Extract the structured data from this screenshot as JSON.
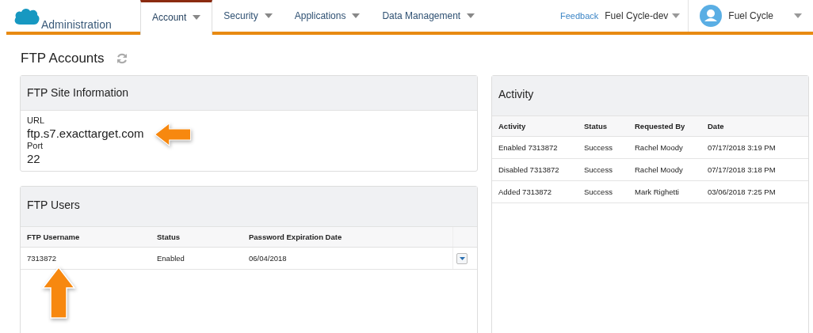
{
  "header": {
    "app_name": "Administration",
    "tabs": [
      {
        "label": "Account",
        "selected": true
      },
      {
        "label": "Security",
        "selected": false
      },
      {
        "label": "Applications",
        "selected": false
      },
      {
        "label": "Data Management",
        "selected": false
      }
    ],
    "feedback": "Feedback",
    "org": "Fuel Cycle-dev",
    "user": "Fuel Cycle"
  },
  "page_title": "FTP Accounts",
  "site_info": {
    "title": "FTP Site Information",
    "fields": [
      {
        "label": "URL",
        "value": "ftp.s7.exacttarget.com"
      },
      {
        "label": "Port",
        "value": "22"
      }
    ]
  },
  "users": {
    "title": "FTP Users",
    "columns": [
      "FTP Username",
      "Status",
      "Password Expiration Date"
    ],
    "rows": [
      [
        "7313872",
        "Enabled",
        "06/04/2018"
      ]
    ]
  },
  "activity": {
    "title": "Activity",
    "columns": [
      "Activity",
      "Status",
      "Requested By",
      "Date"
    ],
    "rows": [
      [
        "Enabled 7313872",
        "Success",
        "Rachel Moody",
        "07/17/2018 3:19 PM"
      ],
      [
        "Disabled 7313872",
        "Success",
        "Rachel Moody",
        "07/17/2018 3:18 PM"
      ],
      [
        "Added 7313872",
        "Success",
        "Mark Righetti",
        "03/06/2018 7:25 PM"
      ]
    ]
  }
}
